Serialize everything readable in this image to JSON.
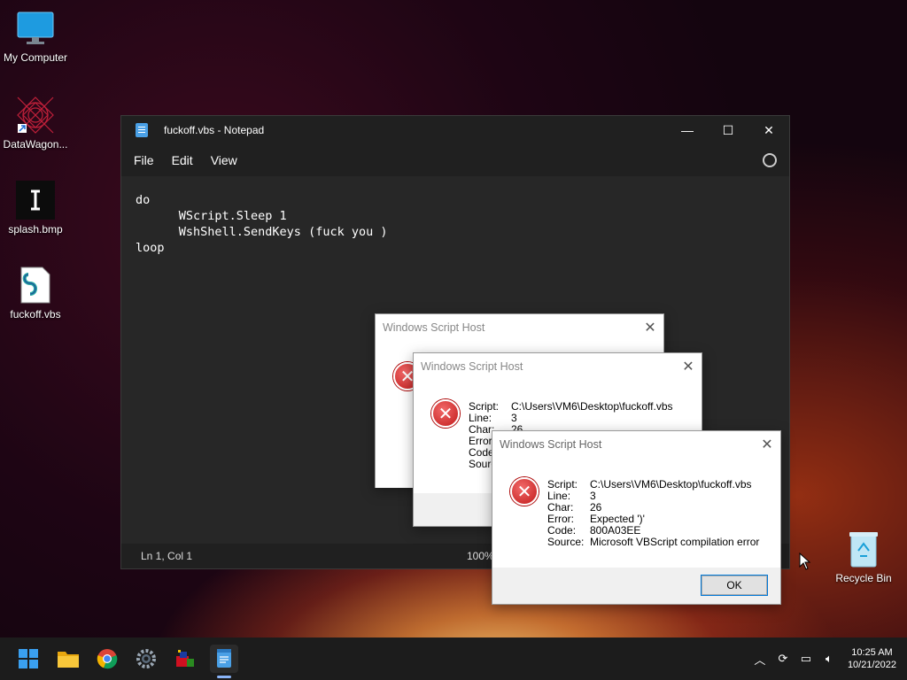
{
  "desktop": {
    "icons": [
      {
        "label": "My Computer",
        "icon": "monitor-icon"
      },
      {
        "label": "DataWagon...",
        "icon": "fractal-shortcut-icon"
      },
      {
        "label": "splash.bmp",
        "icon": "bitmap-file-icon"
      },
      {
        "label": "fuckoff.vbs",
        "icon": "script-file-icon"
      },
      {
        "label": "Recycle Bin",
        "icon": "recycle-bin-icon"
      }
    ]
  },
  "notepad": {
    "title": "fuckoff.vbs - Notepad",
    "menu": [
      "File",
      "Edit",
      "View"
    ],
    "content": "do\n      WScript.Sleep 1\n      WshShell.SendKeys (fuck you )\nloop",
    "status": {
      "position": "Ln 1, Col 1",
      "zoom": "100%"
    },
    "caption": {
      "minimize": "—",
      "maximize": "☐",
      "close": "✕"
    }
  },
  "dialogs": [
    {
      "title": "Windows Script Host",
      "fields": []
    },
    {
      "title": "Windows Script Host",
      "fields": [
        {
          "key": "Script:",
          "value": "C:\\Users\\VM6\\Desktop\\fuckoff.vbs"
        },
        {
          "key": "Line:",
          "value": "3"
        },
        {
          "key": "Char:",
          "value": "26"
        },
        {
          "key": "Error:",
          "value": ""
        },
        {
          "key": "Code:",
          "value": ""
        },
        {
          "key": "Source:",
          "value": ""
        }
      ]
    },
    {
      "title": "Windows Script Host",
      "fields": [
        {
          "key": "Script:",
          "value": "C:\\Users\\VM6\\Desktop\\fuckoff.vbs"
        },
        {
          "key": "Line:",
          "value": "3"
        },
        {
          "key": "Char:",
          "value": "26"
        },
        {
          "key": "Error:",
          "value": "Expected ')'"
        },
        {
          "key": "Code:",
          "value": "800A03EE"
        },
        {
          "key": "Source:",
          "value": "Microsoft VBScript compilation error"
        }
      ],
      "ok_label": "OK"
    }
  ],
  "taskbar": {
    "apps": [
      "start-icon",
      "file-explorer-icon",
      "chrome-icon",
      "settings-icon",
      "app-icon",
      "notepad-icon"
    ],
    "tray": {
      "time": "10:25 AM",
      "date": "10/21/2022"
    }
  },
  "colors": {
    "accent": "#0078d7",
    "error": "#c11a1a",
    "notepad_bg": "#272727"
  }
}
